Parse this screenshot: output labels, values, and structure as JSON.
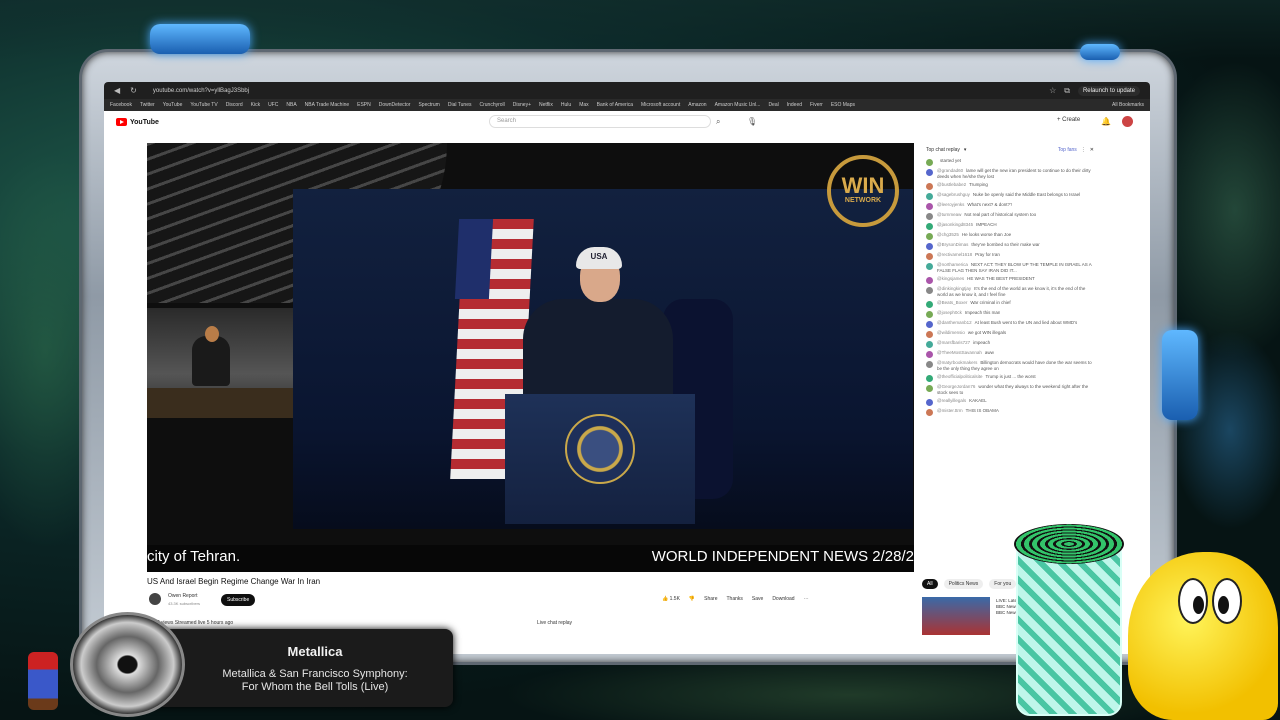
{
  "browser": {
    "url": "youtube.com/watch?v=yllBagJ3Sbbj",
    "relaunch_label": "Relaunch to update",
    "bookmarks": [
      "Facebook",
      "Twitter",
      "YouTube",
      "YouTube TV",
      "Discord",
      "Kick",
      "UFC",
      "NBA",
      "NBA Trade Machine",
      "ESPN",
      "DownDetector",
      "Spectrum",
      "Dial Tunes",
      "Crunchyroll",
      "Disney+",
      "Netflix",
      "Hulu",
      "Max",
      "Bank of America",
      "Microsoft account",
      "Amazon",
      "Amazon Music Unl...",
      "Deal",
      "Indeed",
      "Fiverr",
      "ESO Maps"
    ],
    "all_bookmarks": "All Bookmarks"
  },
  "youtube": {
    "logo": "YouTube",
    "search_placeholder": "Search",
    "create_label": "+ Create"
  },
  "video": {
    "network_logo_main": "WIN",
    "network_logo_sub": "NETWORK",
    "hat_text": "USA",
    "ticker_left": "city of Tehran.",
    "ticker_right": "WORLD INDEPENDENT NEWS 2/28/2",
    "title": "US And Israel Begin Regime Change War In Iran",
    "channel": "Owen Report",
    "subscribers": "43.3K subscribers",
    "subscribe_label": "Subscribe",
    "views": "2,027 views  Streamed live 5 hours ago",
    "actions": [
      "1.5K",
      "Share",
      "Thanks",
      "Save",
      "Download"
    ],
    "live_chat_replay_label": "Live chat replay"
  },
  "chat": {
    "header": "Top chat replay",
    "top_fans": "Top fans",
    "messages": [
      {
        "author": "",
        "text": "started yet"
      },
      {
        "author": "@grandad60",
        "text": "lame will get the new iran president to continue to do their dirty deeds when he/she they lost"
      },
      {
        "author": "@bustlebabe2",
        "text": "Trumping"
      },
      {
        "author": "@sagebrushguy",
        "text": "Nuke be openly said the Middle East belongs to Israel"
      },
      {
        "author": "@leeroyjenks",
        "text": "What's next? & dont??"
      },
      {
        "author": "@turnmeaw",
        "text": "Not real part of historical system too"
      },
      {
        "author": "@jasonkingd8345",
        "text": "IMPEACH"
      },
      {
        "author": "@chg3525",
        "text": "He looks worse than Joe"
      },
      {
        "author": "@BrysonDimas",
        "text": "they've bombed so their make war"
      },
      {
        "author": "@rectivamel1618",
        "text": "Pray for Iran"
      },
      {
        "author": "@northamerica",
        "text": "NEXT ACT: THEY BLOW UP THE TEMPLE IN ISRAEL AS A FALSE FLAG THEN SAY IRAN DID IT..."
      },
      {
        "author": "@kingsjames",
        "text": "HE WAS THE BEST PRESIDENT"
      },
      {
        "author": "@dinkingkingtjay",
        "text": "It's the end of the world as we know it, it's the end of the world as we know it, and I feel fine"
      },
      {
        "author": "@Beats_Boxer",
        "text": "War criminal in chief"
      },
      {
        "author": "@joseph0ck",
        "text": "Impeach this man"
      },
      {
        "author": "@danthemanb12",
        "text": "At least Bush went to the UN and lied about WMD's"
      },
      {
        "author": "@wildimensio",
        "text": "we got WIN illegals"
      },
      {
        "author": "@marsfbaris727",
        "text": "impeach"
      },
      {
        "author": "@TheeMostSavannah",
        "text": "aww"
      },
      {
        "author": "@matyrbookmakers",
        "text": "Billington democrats would have done the war seems to be the only thing they agree on"
      },
      {
        "author": "@theofficialpoliticalsite",
        "text": "Trump is just ... the worst"
      },
      {
        "author": "@GeorgeJordan76",
        "text": "wonder what they always to the weekend right after the stock sees to"
      },
      {
        "author": "@reallyillegals",
        "text": "KAKAEL"
      },
      {
        "author": "@mister.ttrm",
        "text": "THIS IS OBAMA"
      }
    ],
    "chips": [
      "All",
      "Politics News",
      "For you"
    ],
    "suggested_title": "LIVE: Latest BBC News",
    "suggested_channel": "BBC News"
  },
  "now_playing": {
    "artist": "Metallica",
    "track_line1": "Metallica & San Francisco Symphony:",
    "track_line2": "For Whom the Bell Tolls (Live)"
  }
}
